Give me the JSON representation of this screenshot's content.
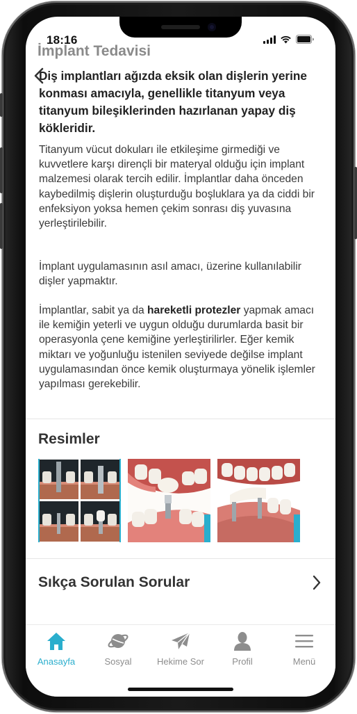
{
  "status_bar": {
    "time": "18:16"
  },
  "header": {
    "title": "İmplant Tedavisi"
  },
  "article": {
    "lead": "Diş implantları ağızda eksik olan dişlerin yerine konması amacıyla, genellikle titanyum veya titanyum bileşiklerinden hazırlanan yapay diş kökleridir.",
    "p1": "Titanyum vücut dokuları ile etkileşime girmediği ve kuvvetlere karşı dirençli bir materyal olduğu için implant malzemesi olarak tercih edilir. İmplantlar daha önceden kaybedilmiş dişlerin oluşturduğu boşluklara ya da ciddi bir enfeksiyon yoksa hemen çekim sonrası diş yuvasına yerleştirilebilir.",
    "p2": "İmplant uygulamasının asıl amacı, üzerine kullanılabilir dişler yapmaktır.",
    "p3_start": "İmplantlar, sabit ya da ",
    "p3_bold": "hareketli protezler",
    "p3_end": " yapmak amacı ile kemiğin yeterli ve uygun olduğu durumlarda basit bir operasyonla çene kemiğine yerleştirilirler. Eğer kemik miktarı ve yoğunluğu istenilen seviyede değilse implant uygulamasından önce kemik oluşturmaya yönelik işlemler yapılması gerekebilir."
  },
  "images_section": {
    "title": "Resimler"
  },
  "faq": {
    "label": "Sıkça Sorulan Sorular"
  },
  "tabs": [
    {
      "label": "Anasayfa",
      "icon": "home-icon",
      "active": true
    },
    {
      "label": "Sosyal",
      "icon": "planet-icon",
      "active": false
    },
    {
      "label": "Hekime Sor",
      "icon": "paper-plane-icon",
      "active": false
    },
    {
      "label": "Profil",
      "icon": "user-icon",
      "active": false
    },
    {
      "label": "Menü",
      "icon": "menu-icon",
      "active": false
    }
  ],
  "colors": {
    "accent": "#2aaecd",
    "inactive": "#8d8d8d",
    "text": "#222222"
  }
}
